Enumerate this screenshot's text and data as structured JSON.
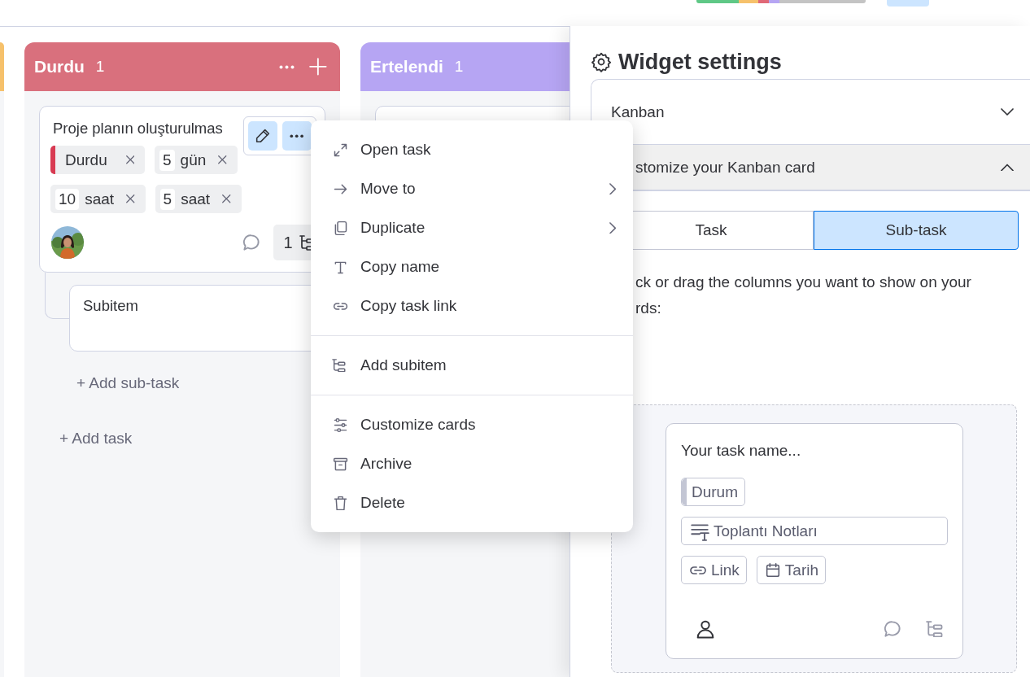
{
  "board": {
    "columns": [
      {
        "kind": "partial",
        "color": "#f6c16b"
      },
      {
        "kind": "full",
        "title": "Durdu",
        "count": "1",
        "color": "#d9707d",
        "header_actions": true,
        "cards": [
          {
            "kind": "task",
            "title": "Proje planın oluşturulmas",
            "hovered": true,
            "tags": [
              {
                "kind": "status",
                "label": "Durdu",
                "color": "#d83a52"
              },
              {
                "kind": "number",
                "value": "5",
                "unit": "gün"
              },
              {
                "kind": "number",
                "value": "10",
                "unit": "saat"
              },
              {
                "kind": "number",
                "value": "5",
                "unit": "saat"
              }
            ],
            "subitem_count": "1",
            "subitems": [
              {
                "title": "Subitem"
              }
            ],
            "add_subtask": "+ Add sub-task"
          }
        ],
        "add_task": "+ Add task"
      },
      {
        "kind": "full",
        "title": "Ertelendi",
        "count": "1",
        "color": "#b6a5f3",
        "cards": [
          {
            "kind": "covered"
          }
        ]
      }
    ]
  },
  "context_menu": {
    "items": [
      {
        "kind": "item",
        "label": "Open task",
        "submenu": false
      },
      {
        "kind": "item",
        "label": "Move to",
        "submenu": true
      },
      {
        "kind": "item",
        "label": "Duplicate",
        "submenu": true
      },
      {
        "kind": "item",
        "label": "Copy name",
        "submenu": false
      },
      {
        "kind": "item",
        "label": "Copy task link",
        "submenu": false
      },
      {
        "kind": "divider"
      },
      {
        "kind": "item",
        "label": "Add subitem",
        "submenu": false
      },
      {
        "kind": "divider"
      },
      {
        "kind": "item",
        "label": "Customize cards",
        "submenu": false
      },
      {
        "kind": "item",
        "label": "Archive",
        "submenu": false
      },
      {
        "kind": "item",
        "label": "Delete",
        "submenu": false
      }
    ]
  },
  "settings": {
    "title": "Widget settings",
    "sections": [
      {
        "label": "Kanban",
        "expanded": false
      },
      {
        "label": "stomize your Kanban card",
        "expanded": true
      }
    ],
    "segments": [
      {
        "label": "Task",
        "selected": false
      },
      {
        "label": "Sub-task",
        "selected": true
      }
    ],
    "instruction_lines": [
      "ck or drag the columns you want to show on your",
      "rds:"
    ],
    "preview": {
      "task_name": "Your task name...",
      "fields": [
        {
          "kind": "status",
          "label": "Durum"
        },
        {
          "kind": "text",
          "label": "Toplantı Notları"
        },
        {
          "kind": "link",
          "label": "Link"
        },
        {
          "kind": "date",
          "label": "Tarih"
        }
      ]
    }
  }
}
